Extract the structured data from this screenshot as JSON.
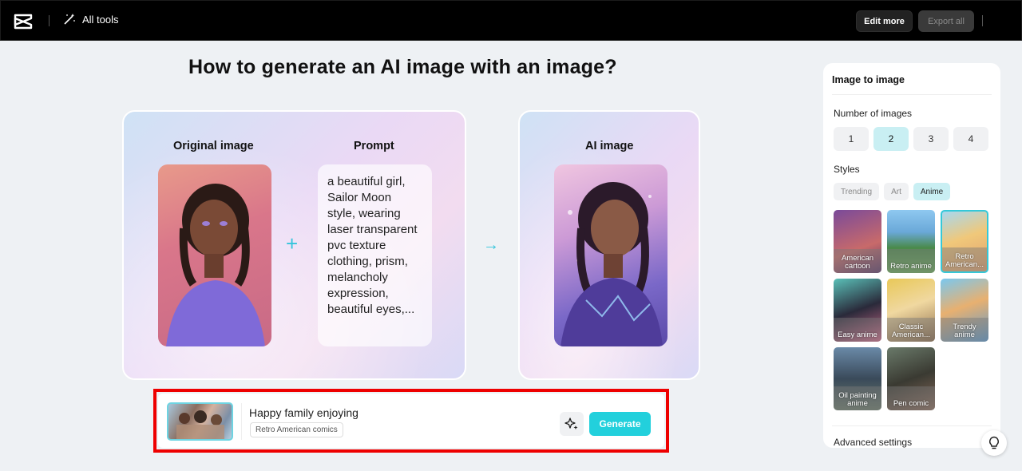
{
  "topbar": {
    "all_tools_label": "All tools",
    "edit_more_label": "Edit more",
    "export_all_label": "Export all",
    "logo_icon": "capcut-logo-icon",
    "all_tools_icon": "magic-wand-icon"
  },
  "main": {
    "title": "How to generate an AI image with an image?",
    "original_label": "Original image",
    "prompt_label": "Prompt",
    "ai_label": "AI image",
    "prompt_text": "a beautiful girl, Sailor Moon style, wearing laser transparent pvc texture clothing, prism, melancholy expression, beautiful eyes,...",
    "plus_symbol": "+",
    "arrow_symbol": "→"
  },
  "generate_bar": {
    "prompt": "Happy family enjoying",
    "style_tag": "Retro American comics",
    "generate_label": "Generate",
    "magic_icon": "sparkle-icon"
  },
  "panel": {
    "title": "Image to image",
    "number_label": "Number of images",
    "numbers": [
      "1",
      "2",
      "3",
      "4"
    ],
    "selected_number": "2",
    "styles_label": "Styles",
    "style_tabs": [
      "Trending",
      "Art",
      "Anime"
    ],
    "selected_tab": "Anime",
    "styles": [
      {
        "label": "American cartoon"
      },
      {
        "label": "Retro anime"
      },
      {
        "label": "Retro American..."
      },
      {
        "label": "Easy anime"
      },
      {
        "label": "Classic American..."
      },
      {
        "label": "Trendy anime"
      },
      {
        "label": "Oil painting anime"
      },
      {
        "label": "Pen comic"
      }
    ],
    "selected_style": "Retro American...",
    "advanced_label": "Advanced settings"
  },
  "colors": {
    "accent": "#22d0dc",
    "highlight": "#ee0000"
  }
}
